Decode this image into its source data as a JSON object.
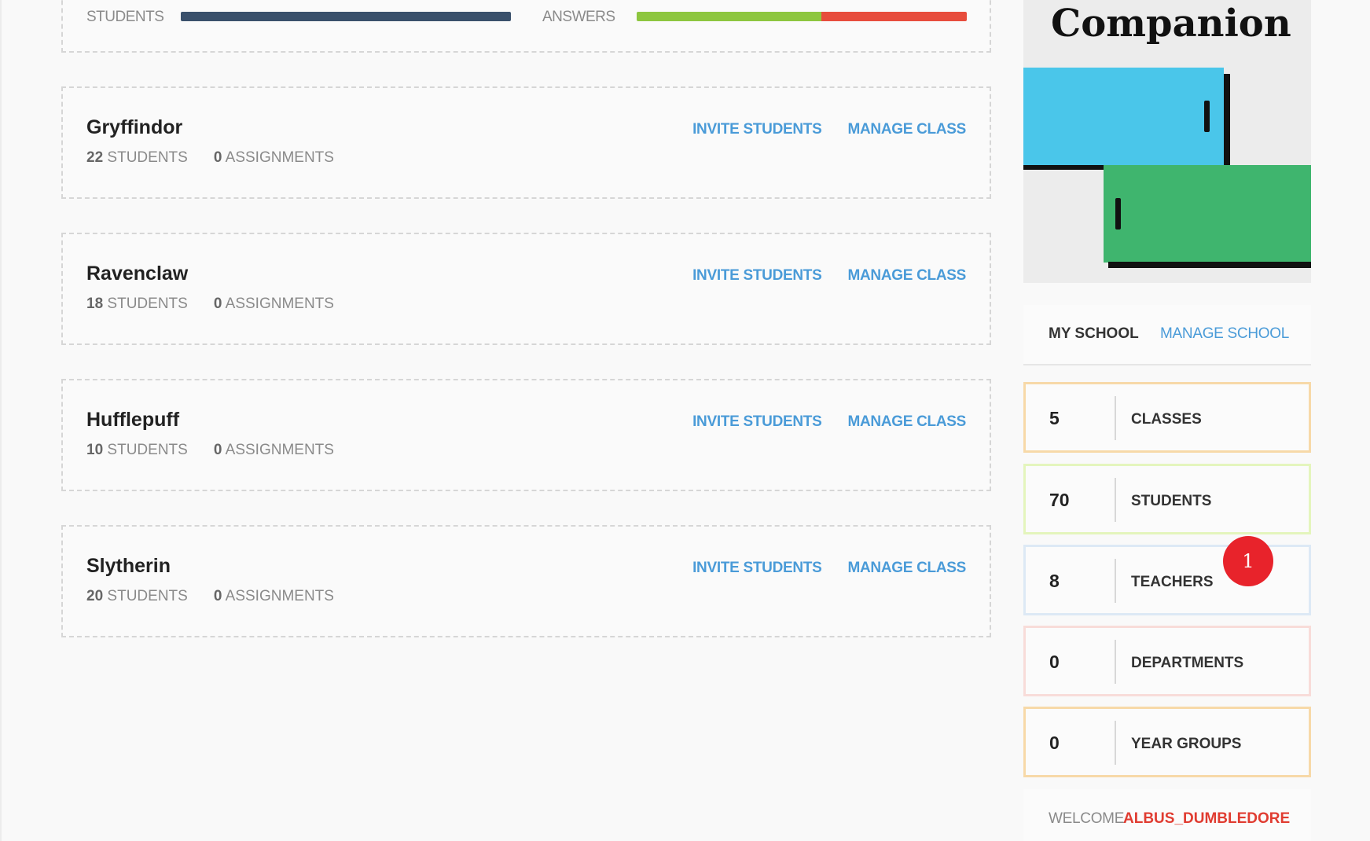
{
  "summary": {
    "students_label": "STUDENTS",
    "answers_label": "ANSWERS",
    "answers_correct_fraction": 0.56,
    "colors": {
      "students_bar": "#3a506b",
      "answers_correct": "#8dc63f",
      "answers_wrong": "#e74c3c"
    }
  },
  "classes": [
    {
      "name": "Gryffindor",
      "students_count": "22",
      "students_label": "STUDENTS",
      "assignments_count": "0",
      "assignments_label": "ASSIGNMENTS",
      "invite_label": "INVITE STUDENTS",
      "manage_label": "MANAGE CLASS"
    },
    {
      "name": "Ravenclaw",
      "students_count": "18",
      "students_label": "STUDENTS",
      "assignments_count": "0",
      "assignments_label": "ASSIGNMENTS",
      "invite_label": "INVITE STUDENTS",
      "manage_label": "MANAGE CLASS"
    },
    {
      "name": "Hufflepuff",
      "students_count": "10",
      "students_label": "STUDENTS",
      "assignments_count": "0",
      "assignments_label": "ASSIGNMENTS",
      "invite_label": "INVITE STUDENTS",
      "manage_label": "MANAGE CLASS"
    },
    {
      "name": "Slytherin",
      "students_count": "20",
      "students_label": "STUDENTS",
      "assignments_count": "0",
      "assignments_label": "ASSIGNMENTS",
      "invite_label": "INVITE STUDENTS",
      "manage_label": "MANAGE CLASS"
    }
  ],
  "brand": {
    "logo_text": "Companion",
    "colors": {
      "blue_book": "#4ac6ea",
      "green_book": "#3fb56e",
      "link": "#4a9bd8"
    }
  },
  "school_nav": {
    "my_school": "MY SCHOOL",
    "manage_school": "MANAGE SCHOOL"
  },
  "stats": [
    {
      "value": "5",
      "label": "CLASSES",
      "border": "#f7d9a8"
    },
    {
      "value": "70",
      "label": "STUDENTS",
      "border": "#e4f5bd"
    },
    {
      "value": "8",
      "label": "TEACHERS",
      "border": "#dde9f5"
    },
    {
      "value": "0",
      "label": "DEPARTMENTS",
      "border": "#f8dcd9"
    },
    {
      "value": "0",
      "label": "YEAR GROUPS",
      "border": "#f7d9a8"
    }
  ],
  "notification": {
    "count": "1"
  },
  "welcome": {
    "prefix": "WELCOME",
    "username": "ALBUS_DUMBLEDORE"
  }
}
